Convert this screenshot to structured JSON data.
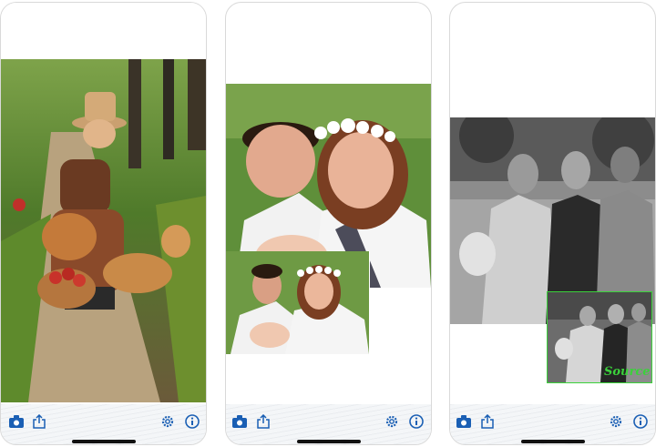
{
  "screens": [
    {
      "photo": "dog-face-swap-autumn-park",
      "toolbar": {
        "camera": "camera-icon",
        "share": "share-icon",
        "settings": "gear-icon",
        "info": "info-icon"
      }
    },
    {
      "photo": "couple-face-swap-result",
      "inset": "couple-source-photo",
      "toolbar": {
        "camera": "camera-icon",
        "share": "share-icon",
        "settings": "gear-icon",
        "info": "info-icon"
      }
    },
    {
      "photo": "grayscale-group-face-swap",
      "inset": "group-source-photo",
      "inset_label": "Source",
      "toolbar": {
        "camera": "camera-icon",
        "share": "share-icon",
        "settings": "gear-icon",
        "info": "info-icon"
      }
    }
  ],
  "colors": {
    "accent": "#1a5fb4",
    "watermark": "#3bd13b"
  }
}
